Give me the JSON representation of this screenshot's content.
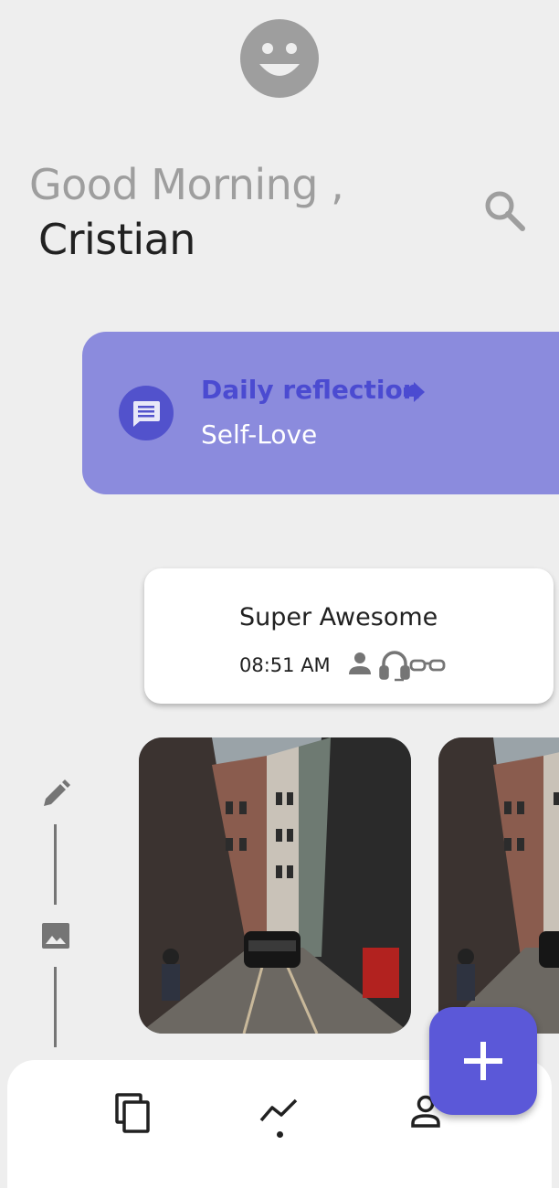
{
  "header": {
    "mood_icon": "smiley-face-icon",
    "greeting": "Good Morning ,",
    "username": "Cristian",
    "search_icon": "search-icon"
  },
  "reflection_card": {
    "title": "Daily reflection",
    "subtitle": "Self-Love",
    "icon": "message-icon",
    "arrow_icon": "arrow-right-icon"
  },
  "entry": {
    "title": "Super Awesome",
    "time": "08:51 AM",
    "tag_icons": [
      "person-icon",
      "headphones-icon",
      "glasses-icon"
    ]
  },
  "timeline": {
    "icons": [
      "pencil-icon",
      "image-icon"
    ]
  },
  "photos": [
    "street-photo",
    "street-photo"
  ],
  "bottom_nav": {
    "items": [
      "entries-icon",
      "stats-icon",
      "profile-icon"
    ],
    "active": "stats-icon"
  },
  "fab": {
    "icon": "plus-icon"
  },
  "colors": {
    "background": "#eeeeee",
    "reflection_bg": "#8b8bdd",
    "accent": "#4b4bd1",
    "fab": "#5b58d8"
  }
}
